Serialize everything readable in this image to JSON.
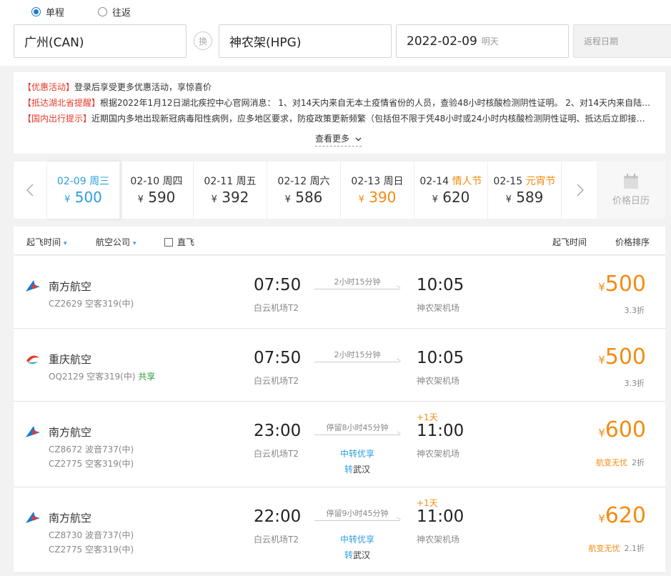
{
  "search": {
    "one_way": "单程",
    "round_trip": "往返",
    "from": "广州(CAN)",
    "swap": "换",
    "to": "神农架(HPG)",
    "depart_date": "2022-02-09",
    "depart_hint": "明天",
    "return_placeholder": "返程日期"
  },
  "notice": {
    "rows": [
      {
        "tag": "【优惠活动】",
        "text": "登录后享受更多优惠活动，享惊喜价"
      },
      {
        "tag": "【抵达湖北省提醒】",
        "text": "根据2022年1月12日湖北疾控中心官网消息： 1、对14天内来自无本土疫情省份的人员，查验48小时核酸检测阴性证明。 2、对14天内来自陆路..."
      },
      {
        "tag": "【国内出行提示】",
        "text": "近期国内多地出现新冠病毒阳性病例，应多地区要求，防疫政策更新频繁（包括但不限于凭48小时或24小时内核酸检测阴性证明、抵达后立即接受..."
      }
    ],
    "more": "查看更多"
  },
  "dates": [
    {
      "date": "02-09",
      "day": "周三",
      "price": "500",
      "currency": "¥"
    },
    {
      "date": "02-10",
      "day": "周四",
      "price": "590",
      "currency": "¥"
    },
    {
      "date": "02-11",
      "day": "周五",
      "price": "392",
      "currency": "¥"
    },
    {
      "date": "02-12",
      "day": "周六",
      "price": "586",
      "currency": "¥"
    },
    {
      "date": "02-13",
      "day": "周日",
      "price": "390",
      "currency": "¥"
    },
    {
      "date": "02-14",
      "day": "情人节",
      "price": "620",
      "currency": "¥"
    },
    {
      "date": "02-15",
      "day": "元宵节",
      "price": "589",
      "currency": "¥"
    }
  ],
  "calendar_label": "价格日历",
  "filters": {
    "depart_time": "起飞时间",
    "airline": "航空公司",
    "direct": "直飞",
    "sort_time": "起飞时间",
    "sort_price": "价格排序"
  },
  "flights": [
    {
      "airline": "南方航空",
      "no1": "CZ2629 空客319(中)",
      "no2": "",
      "share": "",
      "dep_time": "07:50",
      "dep_airport": "白云机场T2",
      "duration": "2小时15分钟",
      "transfer": "",
      "via_prefix": "",
      "via": "",
      "arr_time": "10:05",
      "arr_airport": "神农架机场",
      "plus_day": "",
      "currency": "¥",
      "price": "500",
      "worry": "",
      "discount": "3.3折"
    },
    {
      "airline": "重庆航空",
      "no1": "OQ2129 空客319(中)",
      "no2": "",
      "share": "共享",
      "dep_time": "07:50",
      "dep_airport": "白云机场T2",
      "duration": "2小时15分钟",
      "transfer": "",
      "via_prefix": "",
      "via": "",
      "arr_time": "10:05",
      "arr_airport": "神农架机场",
      "plus_day": "",
      "currency": "¥",
      "price": "500",
      "worry": "",
      "discount": "3.3折"
    },
    {
      "airline": "南方航空",
      "no1": "CZ8672 波音737(中)",
      "no2": "CZ2775 空客319(中)",
      "share": "",
      "dep_time": "23:00",
      "dep_airport": "白云机场T2",
      "duration": "停留8小时45分钟",
      "transfer": "中转优享",
      "via_prefix": "转",
      "via": "武汉",
      "arr_time": "11:00",
      "arr_airport": "神农架机场",
      "plus_day": "+1天",
      "currency": "¥",
      "price": "600",
      "worry": "航变无忧",
      "discount": "2折"
    },
    {
      "airline": "南方航空",
      "no1": "CZ8730 波音737(中)",
      "no2": "CZ2775 空客319(中)",
      "share": "",
      "dep_time": "22:00",
      "dep_airport": "白云机场T2",
      "duration": "停留9小时45分钟",
      "transfer": "中转优享",
      "via_prefix": "转",
      "via": "武汉",
      "arr_time": "11:00",
      "arr_airport": "神农架机场",
      "plus_day": "+1天",
      "currency": "¥",
      "price": "620",
      "worry": "航变无忧",
      "discount": "2.1折"
    }
  ]
}
